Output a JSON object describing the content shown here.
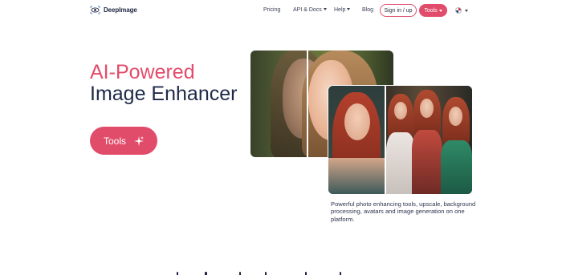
{
  "nav": {
    "logo_text": "DeepImage",
    "links": [
      {
        "label": "Pricing",
        "has_caret": false
      },
      {
        "label": "API & Docs",
        "has_caret": true
      },
      {
        "label": "Help",
        "has_caret": true
      },
      {
        "label": "Blog",
        "has_caret": false
      }
    ],
    "signin_label": "Sign in / up",
    "tools_label": "Tools",
    "language_icon": "uk-flag-icon"
  },
  "hero": {
    "title_line1": "AI-Powered",
    "title_line2": "Image Enhancer",
    "cta_label": "Tools",
    "cta_icon": "sparkle-icon",
    "description": "Powerful photo enhancing tools, upscale, background processing, avatars and image generation on one platform."
  },
  "colors": {
    "accent": "#e24c6b",
    "title_dark": "#1e2a48"
  }
}
